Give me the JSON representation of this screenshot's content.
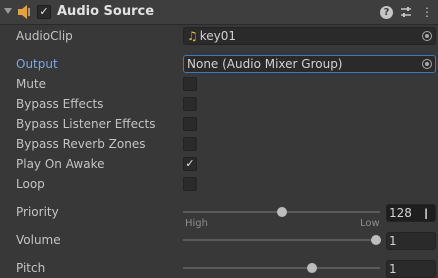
{
  "component": {
    "title": "Audio Source",
    "enabled_check": "✓",
    "icons": [
      "foldout-arrow-icon",
      "speaker-icon",
      "help-icon",
      "preset-sliders-icon",
      "more-vertical-icon"
    ]
  },
  "fields": {
    "audio_clip": {
      "label": "AudioClip",
      "value": "key01",
      "icon": "music-note-icon"
    },
    "output": {
      "label": "Output",
      "value": "None (Audio Mixer Group)"
    },
    "mute": {
      "label": "Mute",
      "checked": false
    },
    "bypass_effects": {
      "label": "Bypass Effects",
      "checked": false
    },
    "bypass_listener_effects": {
      "label": "Bypass Listener Effects",
      "checked": false
    },
    "bypass_reverb_zones": {
      "label": "Bypass Reverb Zones",
      "checked": false
    },
    "play_on_awake": {
      "label": "Play On Awake",
      "checked": true,
      "mark": "✓"
    },
    "loop": {
      "label": "Loop",
      "checked": false
    },
    "priority": {
      "label": "Priority",
      "value": "128",
      "min_label": "High",
      "max_label": "Low",
      "fraction": 0.5
    },
    "volume": {
      "label": "Volume",
      "value": "1",
      "fraction": 1.0
    },
    "pitch": {
      "label": "Pitch",
      "value": "1",
      "fraction": 0.66
    }
  },
  "colors": {
    "link": "#7aa7e6",
    "focus_border": "#3a79bb",
    "speaker": "#e8a23a"
  }
}
